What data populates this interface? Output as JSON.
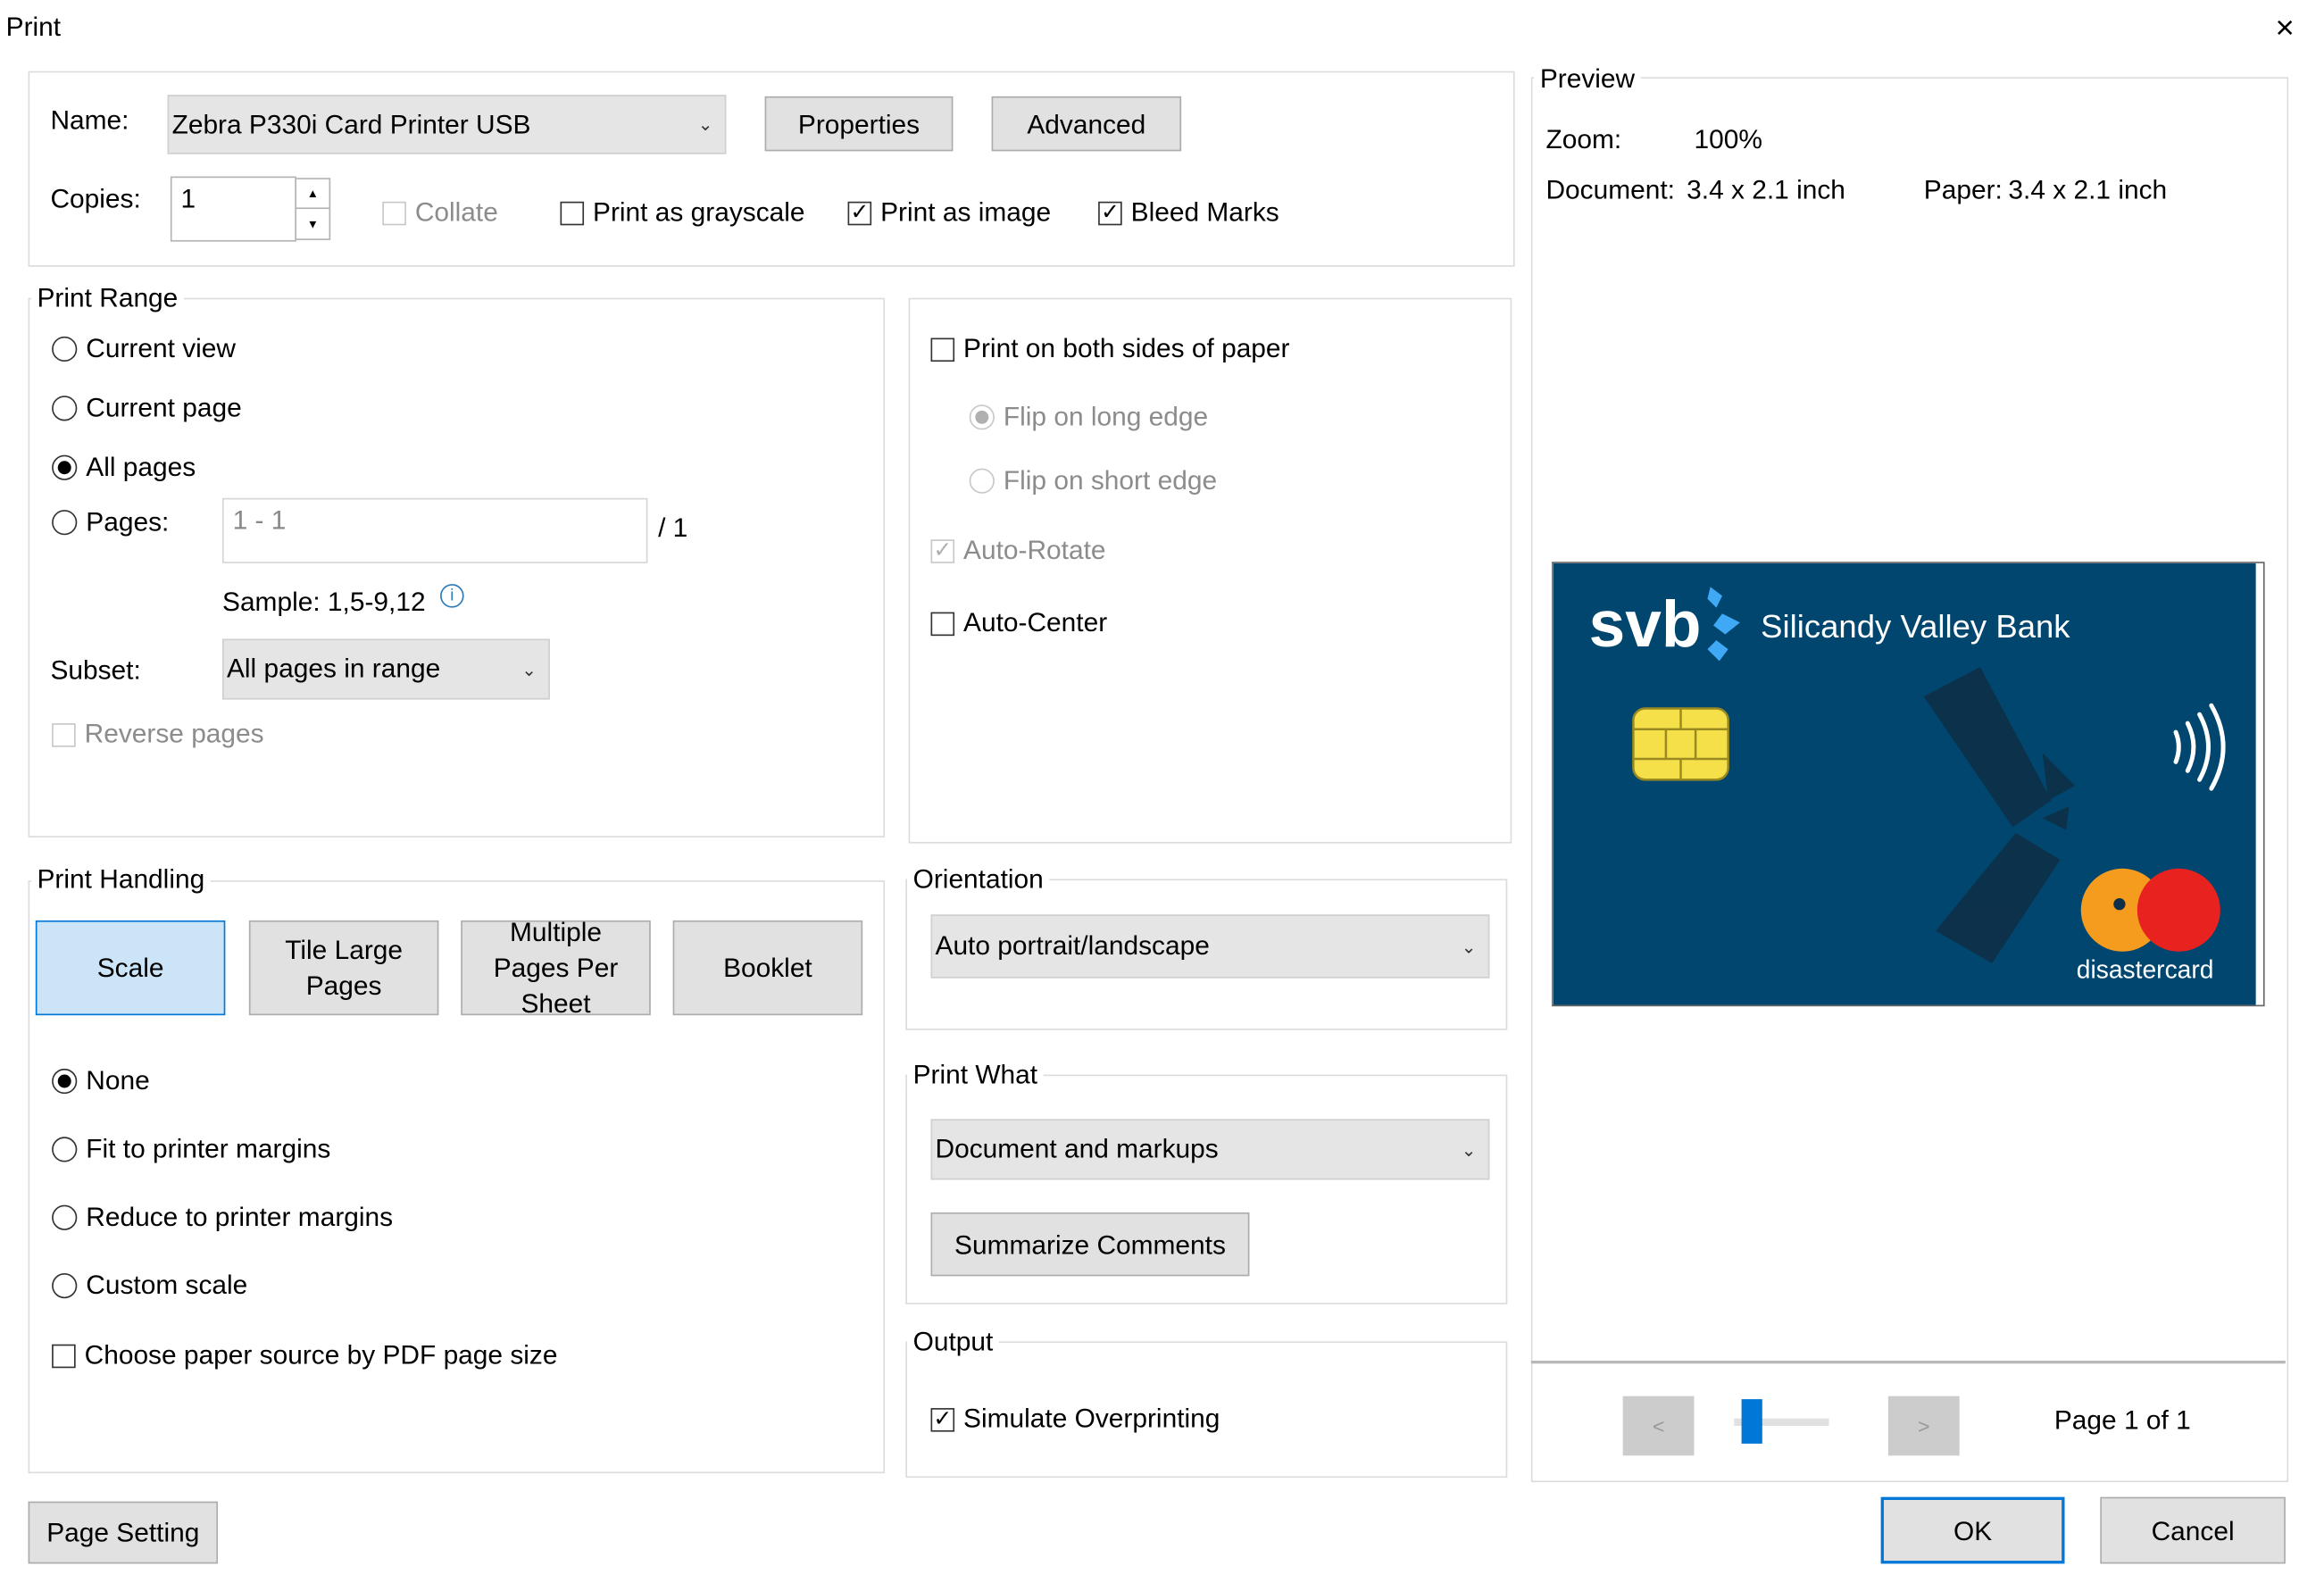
{
  "window": {
    "title": "Print",
    "close_icon": "×"
  },
  "printer": {
    "name_label": "Name:",
    "name_value": "Zebra P330i Card Printer USB",
    "properties_label": "Properties",
    "advanced_label": "Advanced",
    "copies_label": "Copies:",
    "copies_value": "1",
    "collate_label": "Collate",
    "grayscale_label": "Print as grayscale",
    "as_image_label": "Print as image",
    "bleed_label": "Bleed Marks"
  },
  "print_range": {
    "legend": "Print Range",
    "current_view": "Current view",
    "current_page": "Current page",
    "all_pages": "All pages",
    "pages_label": "Pages:",
    "pages_value": "1 - 1",
    "pages_total": "/ 1",
    "sample": "Sample: 1,5-9,12",
    "subset_label": "Subset:",
    "subset_value": "All pages in range",
    "reverse": "Reverse pages"
  },
  "duplex": {
    "both_sides": "Print on both sides of paper",
    "flip_long": "Flip on long edge",
    "flip_short": "Flip on short edge",
    "auto_rotate": "Auto-Rotate",
    "auto_center": "Auto-Center"
  },
  "handling": {
    "legend": "Print Handling",
    "scale": "Scale",
    "tile": "Tile Large Pages",
    "multiple": "Multiple Pages Per Sheet",
    "booklet": "Booklet",
    "none": "None",
    "fit": "Fit to printer margins",
    "reduce": "Reduce to printer margins",
    "custom": "Custom scale",
    "paper_source": "Choose paper source by PDF page size"
  },
  "orientation": {
    "legend": "Orientation",
    "value": "Auto portrait/landscape"
  },
  "print_what": {
    "legend": "Print What",
    "value": "Document and markups",
    "summarize": "Summarize Comments"
  },
  "output": {
    "legend": "Output",
    "simulate": "Simulate Overprinting"
  },
  "preview": {
    "legend": "Preview",
    "zoom_label": "Zoom:",
    "zoom_value": "100%",
    "doc_label": "Document:",
    "doc_value": "3.4 x 2.1 inch",
    "paper_label": "Paper:",
    "paper_value": "3.4 x 2.1 inch",
    "prev": "<",
    "next": ">",
    "page_info": "Page 1 of 1",
    "page_slider_fraction": 0.1
  },
  "card": {
    "logo": "svb",
    "bank_name": "Silicandy Valley Bank",
    "network": "disastercard",
    "bg_color": "#00466e",
    "circle_left": "#f59b1e",
    "circle_right": "#e8221f"
  },
  "footer": {
    "page_setting": "Page Setting",
    "ok": "OK",
    "cancel": "Cancel"
  }
}
